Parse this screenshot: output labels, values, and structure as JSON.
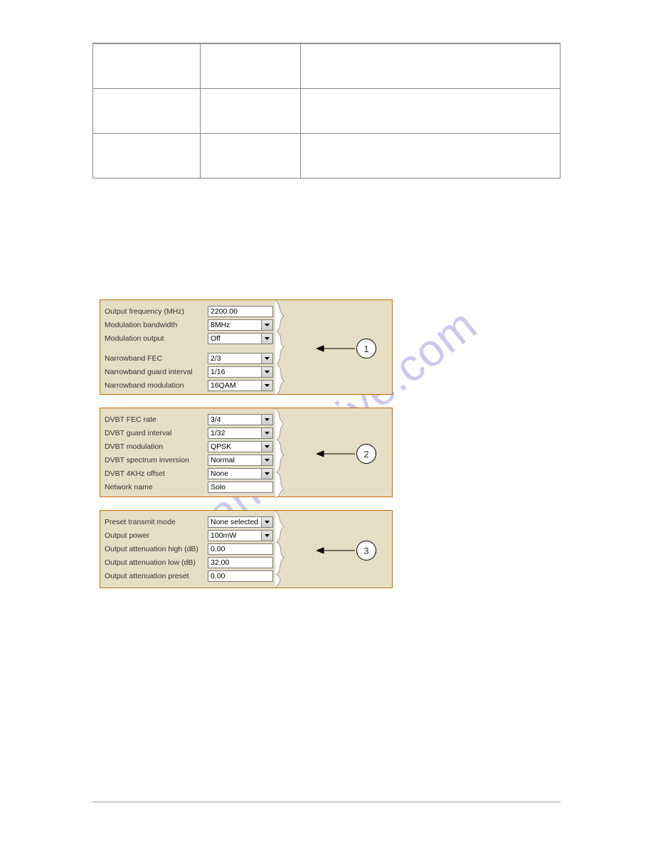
{
  "watermark": "manualshive.com",
  "panel1": {
    "output_frequency_label": "Output frequency (MHz)",
    "output_frequency_value": "2200.00",
    "modulation_bandwidth_label": "Modulation bandwidth",
    "modulation_bandwidth_value": "8MHz",
    "modulation_output_label": "Modulation output",
    "modulation_output_value": "Off",
    "narrowband_fec_label": "Narrowband FEC",
    "narrowband_fec_value": "2/3",
    "narrowband_guard_label": "Narrowband guard interval",
    "narrowband_guard_value": "1/16",
    "narrowband_mod_label": "Narrowband modulation",
    "narrowband_mod_value": "16QAM",
    "callout": "1"
  },
  "panel2": {
    "dvbt_fec_label": "DVBT FEC rate",
    "dvbt_fec_value": "3/4",
    "dvbt_guard_label": "DVBT guard interval",
    "dvbt_guard_value": "1/32",
    "dvbt_mod_label": "DVBT modulation",
    "dvbt_mod_value": "QPSK",
    "dvbt_spectrum_label": "DVBT spectrum inversion",
    "dvbt_spectrum_value": "Normal",
    "dvbt_offset_label": "DVBT 4KHz offset",
    "dvbt_offset_value": "None",
    "network_name_label": "Network name",
    "network_name_value": "Solo",
    "callout": "2"
  },
  "panel3": {
    "preset_mode_label": "Preset transmit mode",
    "preset_mode_value": "None selected",
    "output_power_label": "Output power",
    "output_power_value": "100mW",
    "atten_high_label": "Output attenuation high (dB)",
    "atten_high_value": "0.00",
    "atten_low_label": "Output attenuation low (dB)",
    "atten_low_value": "32.00",
    "atten_preset_label": "Output attenuation preset",
    "atten_preset_value": "0.00",
    "callout": "3"
  }
}
